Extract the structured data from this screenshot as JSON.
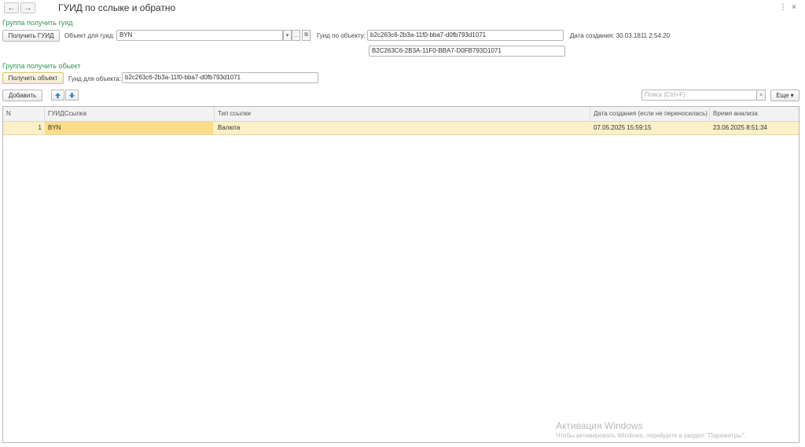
{
  "window": {
    "title": "ГУИД по сслыке и обратно",
    "back_icon": "←",
    "forward_icon": "→",
    "menu_icon": "⋮",
    "close_icon": "×"
  },
  "group_guid": {
    "title": "Группа получить гуид",
    "get_guid_button": "Получить ГУИД",
    "object_label": "Объект для гуид:",
    "object_value": "BYN",
    "guid_label": "Гуид по объекту:",
    "guid_value": "b2c263c6-2b3a-11f0-bba7-d0fb793d1071",
    "guid_upper_value": "B2C263C6-2B3A-11F0-BBA7-D0FB793D1071",
    "created_label": "Дата создания:",
    "created_value": "30.03.1811 2:54:20"
  },
  "group_object": {
    "title": "Группа получить обьект",
    "get_object_button": "Получить объект",
    "guid_label": "Гуид для объекта:",
    "guid_value": "b2c263c6-2b3a-11f0-bba7-d0fb793d1071"
  },
  "toolbar": {
    "add_button": "Добавить",
    "search_placeholder": "Поиск (Ctrl+F)",
    "more_button": "Еще"
  },
  "table": {
    "columns": [
      "N",
      "ГУИДСсылка",
      "Тип ссылки",
      "Дата создания (если не переносилась)",
      "Время анализа"
    ],
    "rows": [
      {
        "n": "1",
        "ref": "BYN",
        "type": "Валюта",
        "created": "07.05.2025 15:59:15",
        "analyzed": "23.06.2025 8:51:34"
      }
    ]
  },
  "watermark": {
    "line1": "Активация Windows",
    "line2": "Чтобы активировать Windows, перейдите в раздел \"Параметры\"."
  },
  "colors": {
    "group_title": "#2e9a4e",
    "selected_row": "#fbf0c6",
    "selected_cell": "#fbdc88",
    "arrow_blue": "#2f7fd3"
  }
}
